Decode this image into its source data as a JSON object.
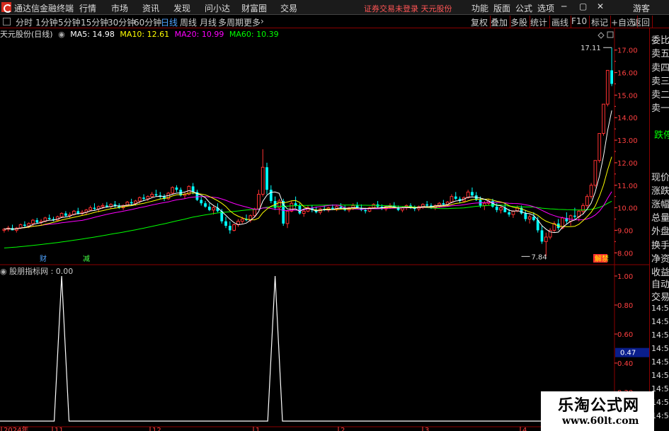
{
  "app": {
    "name": "通达信金融终端",
    "menu": [
      "行情",
      "市场",
      "资讯",
      "发现",
      "问小达",
      "财富圈",
      "交易"
    ],
    "warning": "证券交易未登录  天元股份",
    "right_menu": [
      "功能",
      "版面",
      "公式",
      "选项"
    ],
    "user": "游客"
  },
  "periods": {
    "items": [
      "分时",
      "1分钟",
      "5分钟",
      "15分钟",
      "30分钟",
      "60分钟",
      "日线",
      "周线",
      "月线",
      "多周期",
      "更多"
    ],
    "active": "日线"
  },
  "toolbar": [
    "复权",
    "叠加",
    "多股",
    "统计",
    "画线",
    "F10",
    "标记",
    "+自选",
    "返回"
  ],
  "stock_label": "天元股份(日线)",
  "ma": {
    "ma5": "MA5: 14.98",
    "ma10": "MA10: 12.61",
    "ma20": "MA20: 10.99",
    "ma60": "MA60: 10.39"
  },
  "indicator": {
    "label": "股朋指标网 : 0.00"
  },
  "markers": {
    "high": "17.11",
    "low": "7.84",
    "cai": "财",
    "jian": "减",
    "lockup": "解禁"
  },
  "price_axis": [
    "17.00",
    "16.00",
    "15.00",
    "14.00",
    "13.00",
    "12.00",
    "11.00",
    "10.00",
    "9.00",
    "8.00"
  ],
  "ind_axis": [
    "1.00",
    "0.80",
    "0.60",
    "0.40",
    "0.20"
  ],
  "ind_current": "0.47",
  "date_axis": [
    "2024年",
    "11",
    "12",
    "1",
    "2",
    "3",
    "4"
  ],
  "right_panel": {
    "items": [
      "委比",
      "卖五",
      "卖四",
      "卖三",
      "卖二",
      "卖一",
      "跌停",
      "现价",
      "涨跌",
      "涨幅",
      "总量",
      "外盘",
      "换手",
      "净资",
      "收益",
      "自动",
      "交易",
      "14:56",
      "14:56",
      "14:56",
      "14:56",
      "14:56",
      "14:56",
      "14:56",
      "14:56",
      "14:56"
    ]
  },
  "watermark": {
    "title": "乐淘公式网",
    "url": "www.60lt.com"
  },
  "colors": {
    "up": "#ff3232",
    "down": "#00ffff",
    "ma5": "#ffffff",
    "ma10": "#ffff00",
    "ma20": "#ff00ff",
    "ma60": "#00ff00",
    "grid": "#8b0000",
    "axis_text": "#ff4040"
  },
  "chart_data": {
    "type": "candlestick",
    "title": "天元股份(日线)",
    "xlabel": "",
    "ylabel": "",
    "ylim": [
      7.6,
      17.4
    ],
    "days": 165,
    "ohlc": [
      [
        9.0,
        9.1,
        8.9,
        9.05
      ],
      [
        9.05,
        9.2,
        8.95,
        9.1
      ],
      [
        9.1,
        9.25,
        9.0,
        9.0
      ],
      [
        9.0,
        9.15,
        8.9,
        9.1
      ],
      [
        9.1,
        9.3,
        9.05,
        9.25
      ],
      [
        9.25,
        9.4,
        9.15,
        9.2
      ],
      [
        9.2,
        9.35,
        9.1,
        9.3
      ],
      [
        9.3,
        9.5,
        9.2,
        9.45
      ],
      [
        9.45,
        9.55,
        9.3,
        9.35
      ],
      [
        9.35,
        9.5,
        9.25,
        9.4
      ],
      [
        9.4,
        9.6,
        9.35,
        9.55
      ],
      [
        9.55,
        9.7,
        9.45,
        9.5
      ],
      [
        9.5,
        9.6,
        9.4,
        9.45
      ],
      [
        9.45,
        9.65,
        9.4,
        9.6
      ],
      [
        9.6,
        9.8,
        9.55,
        9.75
      ],
      [
        9.75,
        9.85,
        9.6,
        9.65
      ],
      [
        9.65,
        9.8,
        9.55,
        9.7
      ],
      [
        9.7,
        9.9,
        9.65,
        9.85
      ],
      [
        9.85,
        10.0,
        9.7,
        9.75
      ],
      [
        9.75,
        9.9,
        9.65,
        9.8
      ],
      [
        9.8,
        9.95,
        9.7,
        9.9
      ],
      [
        9.9,
        10.1,
        9.85,
        10.0
      ],
      [
        10.0,
        10.2,
        9.9,
        9.95
      ],
      [
        9.95,
        10.1,
        9.8,
        10.05
      ],
      [
        10.05,
        10.2,
        9.95,
        10.1
      ],
      [
        10.1,
        10.25,
        10.0,
        10.05
      ],
      [
        10.05,
        10.2,
        9.95,
        10.15
      ],
      [
        10.15,
        10.3,
        10.0,
        10.1
      ],
      [
        10.1,
        10.2,
        9.95,
        10.0
      ],
      [
        10.0,
        10.15,
        9.9,
        10.1
      ],
      [
        10.1,
        10.3,
        10.05,
        10.25
      ],
      [
        10.25,
        10.4,
        10.1,
        10.2
      ],
      [
        10.2,
        10.35,
        10.1,
        10.3
      ],
      [
        10.3,
        10.5,
        10.2,
        10.45
      ],
      [
        10.45,
        10.6,
        10.3,
        10.4
      ],
      [
        10.4,
        10.55,
        10.3,
        10.5
      ],
      [
        10.5,
        10.7,
        10.45,
        10.6
      ],
      [
        10.6,
        10.8,
        10.5,
        10.55
      ],
      [
        10.55,
        10.7,
        10.4,
        10.5
      ],
      [
        10.5,
        10.6,
        10.3,
        10.4
      ],
      [
        10.4,
        10.7,
        10.35,
        10.65
      ],
      [
        10.65,
        10.95,
        10.6,
        10.9
      ],
      [
        10.9,
        11.0,
        10.7,
        10.8
      ],
      [
        10.8,
        10.9,
        10.5,
        10.55
      ],
      [
        10.55,
        10.7,
        10.4,
        10.6
      ],
      [
        10.6,
        11.0,
        10.55,
        10.95
      ],
      [
        10.95,
        11.1,
        10.6,
        10.7
      ],
      [
        10.7,
        10.8,
        10.3,
        10.35
      ],
      [
        10.35,
        10.5,
        10.1,
        10.2
      ],
      [
        10.2,
        10.3,
        10.0,
        10.05
      ],
      [
        10.05,
        10.2,
        9.85,
        9.9
      ],
      [
        9.9,
        10.1,
        9.7,
        10.0
      ],
      [
        10.0,
        10.2,
        9.8,
        9.85
      ],
      [
        9.85,
        9.95,
        9.3,
        9.4
      ],
      [
        9.4,
        9.6,
        9.1,
        9.2
      ],
      [
        9.2,
        9.4,
        8.85,
        9.0
      ],
      [
        9.0,
        9.3,
        8.95,
        9.25
      ],
      [
        9.25,
        9.5,
        9.15,
        9.4
      ],
      [
        9.4,
        9.6,
        9.3,
        9.5
      ],
      [
        9.5,
        9.7,
        9.4,
        9.45
      ],
      [
        9.45,
        9.7,
        9.35,
        9.65
      ],
      [
        9.65,
        10.0,
        9.6,
        9.95
      ],
      [
        9.95,
        10.8,
        9.9,
        10.6
      ],
      [
        10.6,
        12.6,
        10.5,
        11.8
      ],
      [
        11.8,
        12.0,
        10.6,
        10.8
      ],
      [
        10.8,
        11.0,
        10.2,
        10.3
      ],
      [
        10.3,
        10.5,
        9.9,
        10.0
      ],
      [
        10.0,
        10.4,
        9.7,
        10.3
      ],
      [
        10.3,
        10.4,
        9.2,
        9.3
      ],
      [
        9.3,
        9.9,
        9.1,
        9.85
      ],
      [
        9.85,
        10.3,
        9.8,
        10.2
      ],
      [
        10.2,
        10.5,
        10.0,
        10.1
      ],
      [
        10.1,
        10.2,
        9.7,
        9.75
      ],
      [
        9.75,
        9.9,
        9.6,
        9.85
      ],
      [
        9.85,
        10.1,
        9.8,
        10.0
      ],
      [
        10.0,
        10.1,
        9.8,
        9.9
      ],
      [
        9.9,
        10.05,
        9.75,
        9.8
      ],
      [
        9.8,
        10.0,
        9.7,
        9.95
      ],
      [
        9.95,
        10.1,
        9.85,
        9.9
      ],
      [
        9.9,
        10.05,
        9.8,
        10.0
      ],
      [
        10.0,
        10.15,
        9.9,
        9.95
      ],
      [
        9.95,
        10.1,
        9.85,
        10.05
      ],
      [
        10.05,
        10.2,
        9.95,
        10.0
      ],
      [
        10.0,
        10.1,
        9.85,
        9.9
      ],
      [
        9.9,
        10.05,
        9.8,
        10.0
      ],
      [
        10.0,
        10.2,
        9.9,
        10.1
      ],
      [
        10.1,
        10.25,
        9.95,
        10.0
      ],
      [
        10.0,
        10.15,
        9.85,
        9.9
      ],
      [
        9.9,
        10.0,
        9.75,
        9.85
      ],
      [
        9.85,
        10.05,
        9.8,
        10.0
      ],
      [
        10.0,
        10.2,
        9.95,
        10.15
      ],
      [
        10.15,
        10.3,
        10.0,
        10.05
      ],
      [
        10.05,
        10.15,
        9.9,
        9.95
      ],
      [
        9.95,
        10.1,
        9.85,
        10.05
      ],
      [
        10.05,
        10.2,
        9.95,
        10.1
      ],
      [
        10.1,
        10.25,
        10.0,
        10.0
      ],
      [
        10.0,
        10.1,
        9.85,
        9.9
      ],
      [
        9.9,
        10.05,
        9.8,
        10.0
      ],
      [
        10.0,
        10.15,
        9.9,
        10.1
      ],
      [
        10.1,
        10.2,
        9.95,
        10.0
      ],
      [
        10.0,
        10.1,
        9.85,
        9.95
      ],
      [
        9.95,
        10.1,
        9.85,
        10.05
      ],
      [
        10.05,
        10.2,
        9.95,
        10.15
      ],
      [
        10.15,
        10.3,
        10.05,
        10.1
      ],
      [
        10.1,
        10.2,
        9.95,
        10.0
      ],
      [
        10.0,
        10.15,
        9.9,
        10.1
      ],
      [
        10.1,
        10.25,
        10.0,
        10.2
      ],
      [
        10.2,
        10.35,
        10.1,
        10.15
      ],
      [
        10.15,
        10.3,
        10.05,
        10.25
      ],
      [
        10.25,
        10.6,
        10.2,
        10.5
      ],
      [
        10.5,
        10.7,
        10.35,
        10.4
      ],
      [
        10.4,
        10.5,
        10.2,
        10.3
      ],
      [
        10.3,
        10.5,
        10.25,
        10.45
      ],
      [
        10.45,
        10.8,
        10.4,
        10.7
      ],
      [
        10.7,
        10.9,
        10.5,
        10.55
      ],
      [
        10.55,
        10.7,
        10.3,
        10.35
      ],
      [
        10.35,
        10.5,
        10.0,
        10.1
      ],
      [
        10.1,
        10.3,
        9.9,
        10.2
      ],
      [
        10.2,
        10.4,
        10.1,
        10.3
      ],
      [
        10.3,
        10.4,
        10.0,
        10.05
      ],
      [
        10.05,
        10.2,
        9.8,
        9.9
      ],
      [
        9.9,
        10.1,
        9.75,
        10.0
      ],
      [
        10.0,
        10.2,
        9.9,
        9.8
      ],
      [
        9.8,
        9.95,
        9.6,
        9.7
      ],
      [
        9.7,
        9.9,
        9.55,
        9.85
      ],
      [
        9.85,
        10.1,
        9.8,
        10.0
      ],
      [
        10.0,
        10.1,
        9.7,
        9.75
      ],
      [
        9.75,
        9.9,
        9.4,
        9.5
      ],
      [
        9.5,
        9.7,
        9.3,
        9.6
      ],
      [
        9.6,
        9.8,
        9.4,
        9.45
      ],
      [
        9.45,
        9.6,
        8.9,
        9.0
      ],
      [
        9.0,
        9.2,
        8.4,
        8.5
      ],
      [
        8.5,
        8.9,
        7.84,
        8.7
      ],
      [
        8.7,
        9.1,
        8.6,
        9.0
      ],
      [
        9.0,
        9.4,
        8.9,
        9.3
      ],
      [
        9.3,
        9.5,
        9.0,
        9.1
      ],
      [
        9.1,
        9.6,
        9.05,
        9.55
      ],
      [
        9.55,
        9.8,
        9.3,
        9.4
      ],
      [
        9.4,
        9.7,
        9.2,
        9.65
      ],
      [
        9.65,
        10.0,
        9.5,
        9.6
      ],
      [
        9.6,
        9.9,
        9.4,
        9.85
      ],
      [
        9.85,
        10.2,
        9.7,
        10.1
      ],
      [
        10.1,
        10.6,
        10.0,
        10.5
      ],
      [
        10.5,
        11.1,
        10.4,
        11.0
      ],
      [
        11.0,
        12.1,
        10.9,
        12.1
      ],
      [
        12.1,
        13.3,
        12.0,
        13.3
      ],
      [
        13.3,
        14.6,
        13.2,
        14.6
      ],
      [
        14.6,
        16.1,
        14.5,
        16.1
      ],
      [
        16.1,
        17.11,
        15.4,
        15.5
      ]
    ],
    "ma_note": "moving averages computed in script from closes",
    "indicator_series": {
      "name": "股朋指标网",
      "spikes_at_day": [
        14,
        66
      ],
      "baseline": 0,
      "spike_value": 1.0
    }
  }
}
